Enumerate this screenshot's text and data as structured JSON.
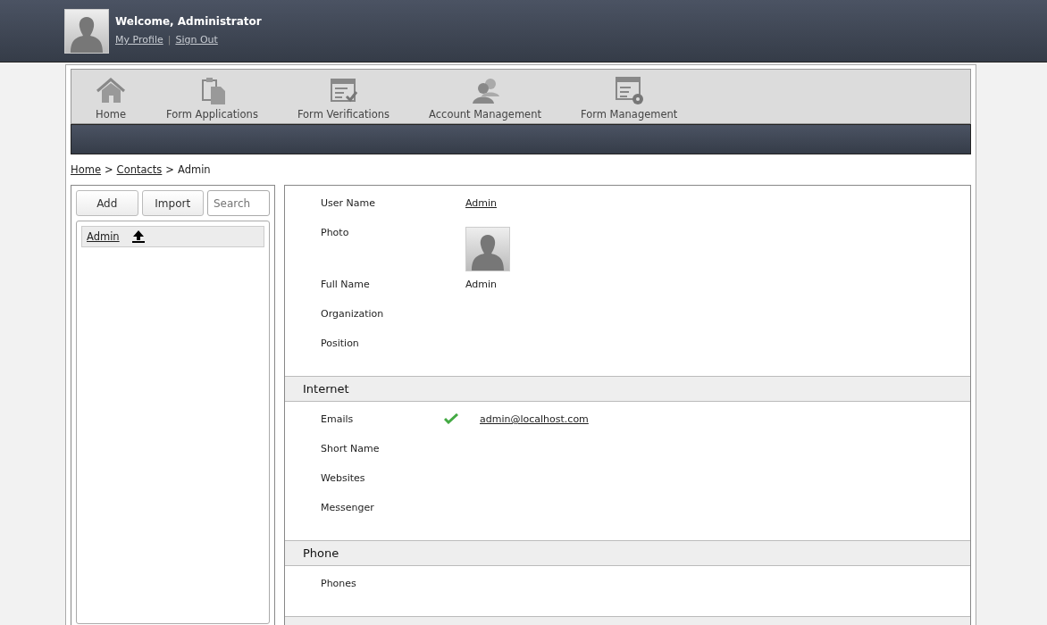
{
  "header": {
    "welcome": "Welcome, Administrator",
    "links": [
      "My Profile",
      "Sign Out"
    ],
    "separator": "|"
  },
  "nav": [
    {
      "label": "Home"
    },
    {
      "label": "Form Applications"
    },
    {
      "label": "Form Verifications"
    },
    {
      "label": "Account Management"
    },
    {
      "label": "Form Management"
    }
  ],
  "breadcrumb": [
    {
      "label": "Home",
      "link": true
    },
    {
      "label": "Contacts",
      "link": true
    },
    {
      "label": "Admin",
      "link": false
    }
  ],
  "breadcrumb_separator": ">",
  "sidebar": {
    "buttons": [
      "Add",
      "Import"
    ],
    "search": {
      "placeholder": "Search"
    },
    "items": [
      {
        "label": "Admin",
        "selected": true
      }
    ]
  },
  "details": [
    {
      "fields": [
        {
          "label": "User Name",
          "kind": "link",
          "value": "Admin"
        },
        {
          "label": "Photo",
          "kind": "photo"
        },
        {
          "label": "Full Name",
          "kind": "text",
          "value": "Admin"
        },
        {
          "label": "Organization",
          "kind": "text"
        },
        {
          "label": "Position",
          "kind": "text"
        }
      ]
    },
    {
      "title": "Internet",
      "fields": [
        {
          "label": "Emails",
          "kind": "email",
          "value": "admin@localhost.com",
          "verified": true
        },
        {
          "label": "Short Name",
          "kind": "text"
        },
        {
          "label": "Websites",
          "kind": "text"
        },
        {
          "label": "Messenger",
          "kind": "text"
        }
      ]
    },
    {
      "title": "Phone",
      "fields": [
        {
          "label": "Phones",
          "kind": "text"
        }
      ]
    }
  ]
}
